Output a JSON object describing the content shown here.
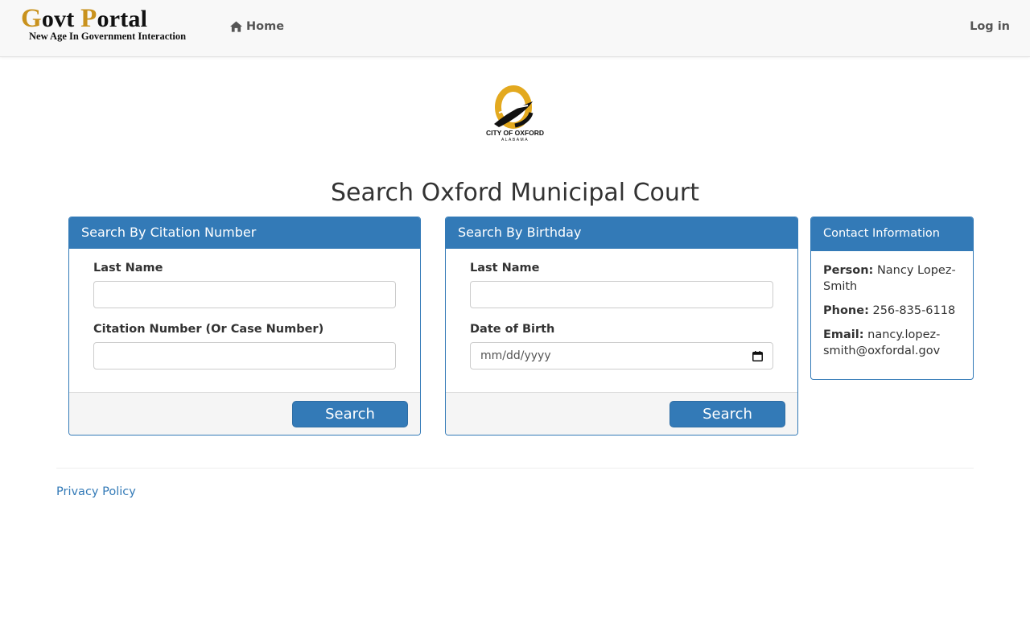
{
  "navbar": {
    "brand": {
      "g_letter": "G",
      "title_part1": "ovt ",
      "p_letter": "P",
      "title_part2": "ortal",
      "tagline": "New Age In Government Interaction"
    },
    "home_label": "Home",
    "login_label": "Log in"
  },
  "logo": {
    "line1": "CITY OF OXFORD",
    "line2": "ALABAMA",
    "colors": {
      "gold": "#e3a91f",
      "black": "#111111"
    }
  },
  "page_title": "Search Oxford Municipal Court",
  "citation_panel": {
    "heading": "Search By Citation Number",
    "last_name_label": "Last Name",
    "last_name_value": "",
    "citation_label": "Citation Number (Or Case Number)",
    "citation_value": "",
    "search_label": "Search"
  },
  "birthday_panel": {
    "heading": "Search By Birthday",
    "last_name_label": "Last Name",
    "last_name_value": "",
    "dob_label": "Date of Birth",
    "dob_placeholder": "mm/dd/yyyy",
    "search_label": "Search"
  },
  "contact_panel": {
    "heading": "Contact Information",
    "person_label": "Person:",
    "person_value": "Nancy Lopez-Smith",
    "phone_label": "Phone:",
    "phone_value": "256-835-6118",
    "email_label": "Email:",
    "email_value": "nancy.lopez-smith@oxfordal.gov"
  },
  "footer": {
    "privacy_label": "Privacy Policy"
  },
  "colors": {
    "primary": "#337ab7",
    "brand_gold": "#c9921d",
    "navbar_bg": "#f8f8f8",
    "footer_bg": "#f5f5f5"
  }
}
